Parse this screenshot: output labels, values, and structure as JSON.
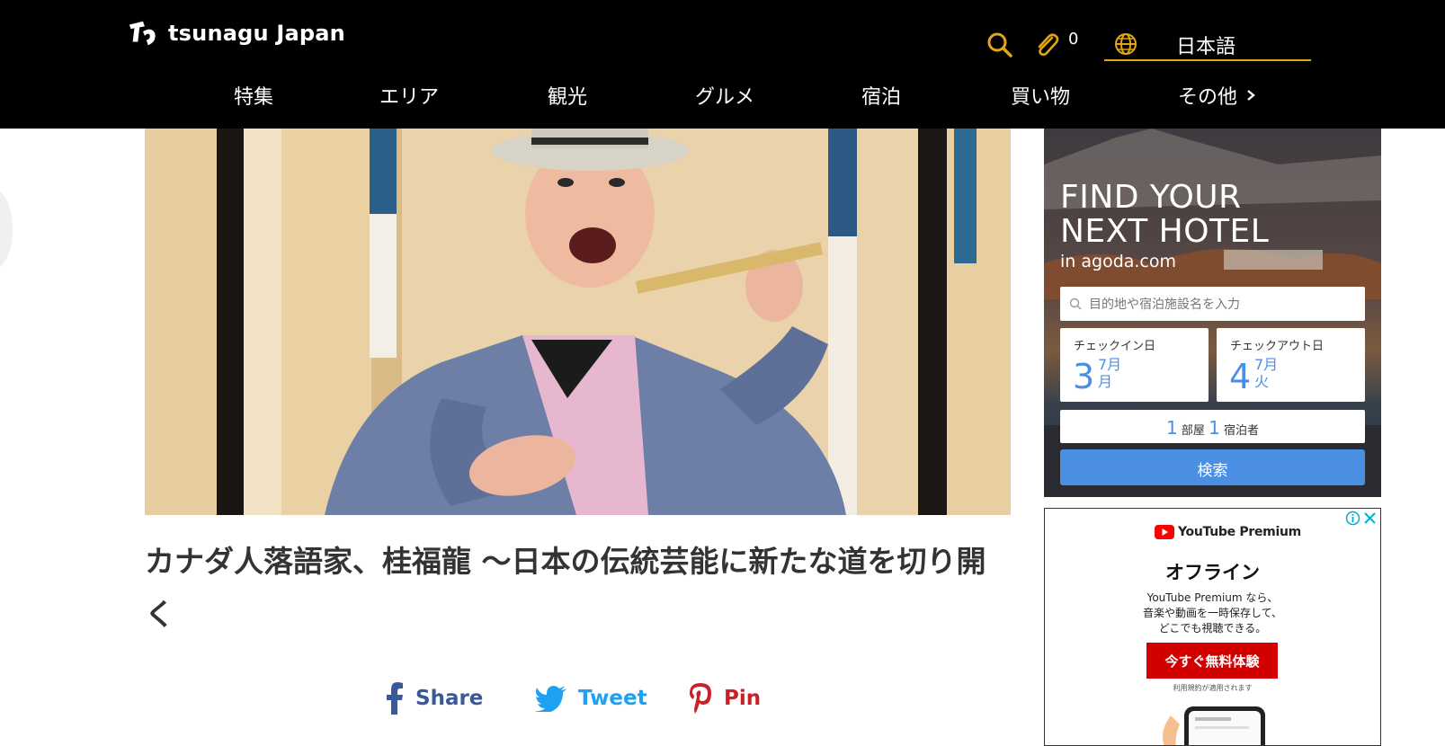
{
  "header": {
    "logo_text": "tsunagu Japan",
    "cart_count": "0",
    "language": "日本語"
  },
  "nav": {
    "items": [
      "特集",
      "エリア",
      "観光",
      "グルメ",
      "宿泊",
      "買い物"
    ],
    "more": "その他"
  },
  "article": {
    "title": "カナダ人落語家、桂福龍 ～日本の伝統芸能に新たな道を切り開く"
  },
  "share": {
    "facebook": "Share",
    "twitter": "Tweet",
    "pinterest": "Pin"
  },
  "agoda_ad": {
    "headline_1": "FIND YOUR",
    "headline_2": "NEXT HOTEL",
    "sub": "in agoda.com",
    "search_placeholder": "目的地や宿泊施設名を入力",
    "checkin_label": "チェックイン日",
    "checkin_day": "3",
    "checkin_month": "7月",
    "checkin_weekday": "月",
    "checkout_label": "チェックアウト日",
    "checkout_day": "4",
    "checkout_month": "7月",
    "checkout_weekday": "火",
    "rooms": "1",
    "rooms_label": "部屋",
    "guests": "1",
    "guests_label": "宿泊者",
    "search_button": "検索"
  },
  "youtube_ad": {
    "brand": "YouTube Premium",
    "headline": "オフライン",
    "body_1": "YouTube Premium なら、",
    "body_2": "音楽や動画を一時保存して、",
    "body_3": "どこでも視聴できる。",
    "cta": "今すぐ無料体験",
    "terms": "利用規約が適用されます"
  },
  "colors": {
    "header_bg": "#000000",
    "accent_gold": "#e3a613",
    "facebook": "#3b5998",
    "twitter": "#1da1f2",
    "pinterest": "#cb2027",
    "agoda_blue": "#4b8fe5",
    "youtube_red": "#d30000"
  }
}
